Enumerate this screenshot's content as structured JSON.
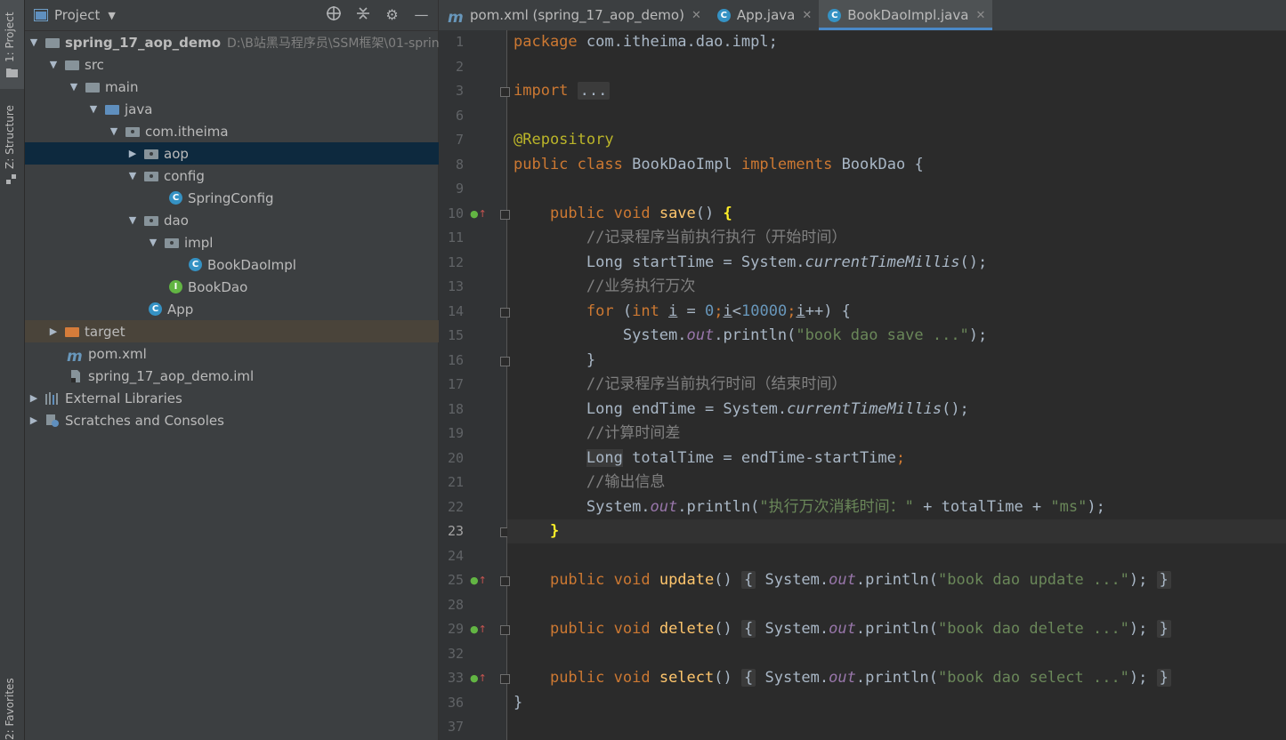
{
  "left_strip": {
    "project_tab": "1: Project",
    "structure_tab": "Z: Structure",
    "favorites_tab": "2: Favorites"
  },
  "project_panel": {
    "title": "Project",
    "tree": [
      {
        "label": "spring_17_aop_demo",
        "path": "D:\\B站黑马程序员\\SSM框架\\01-sprin",
        "icon": "module-folder-icon"
      },
      {
        "label": "src",
        "icon": "folder-icon"
      },
      {
        "label": "main",
        "icon": "folder-icon"
      },
      {
        "label": "java",
        "icon": "source-folder-icon"
      },
      {
        "label": "com.itheima",
        "icon": "package-icon"
      },
      {
        "label": "aop",
        "icon": "package-icon"
      },
      {
        "label": "config",
        "icon": "package-icon"
      },
      {
        "label": "SpringConfig",
        "icon": "class-icon"
      },
      {
        "label": "dao",
        "icon": "package-icon"
      },
      {
        "label": "impl",
        "icon": "package-icon"
      },
      {
        "label": "BookDaoImpl",
        "icon": "class-icon"
      },
      {
        "label": "BookDao",
        "icon": "interface-icon"
      },
      {
        "label": "App",
        "icon": "runnable-class-icon"
      },
      {
        "label": "target",
        "icon": "excluded-folder-icon"
      },
      {
        "label": "pom.xml",
        "icon": "maven-icon"
      },
      {
        "label": "spring_17_aop_demo.iml",
        "icon": "iml-file-icon"
      },
      {
        "label": "External Libraries",
        "icon": "library-icon"
      },
      {
        "label": "Scratches and Consoles",
        "icon": "scratches-icon"
      }
    ]
  },
  "tabs": [
    {
      "label": "pom.xml (spring_17_aop_demo)",
      "icon": "maven-icon"
    },
    {
      "label": "App.java",
      "icon": "runnable-class-icon"
    },
    {
      "label": "BookDaoImpl.java",
      "icon": "class-icon",
      "active": true
    }
  ],
  "editor": {
    "line_numbers": [
      "1",
      "2",
      "3",
      "6",
      "7",
      "8",
      "9",
      "10",
      "11",
      "12",
      "13",
      "14",
      "15",
      "16",
      "17",
      "18",
      "19",
      "20",
      "21",
      "22",
      "23",
      "24",
      "25",
      "28",
      "29",
      "32",
      "33",
      "36",
      "37"
    ],
    "current_line": "23",
    "text": {
      "package_kw": "package",
      "package_name": " com.itheima.dao.impl;",
      "import_kw": "import",
      "import_fold": "...",
      "annotation": "@Repository",
      "public": "public",
      "class": "class",
      "classname": "BookDaoImpl",
      "implements": "implements",
      "iface": "BookDao",
      "open_brace": " {",
      "void": "void",
      "save": "save",
      "update": "update",
      "delete": "delete",
      "select": "select",
      "parens": "()",
      "brace_open": "{",
      "brace_close": "}",
      "comment1": "//记录程序当前执行执行（开始时间）",
      "long_type": "Long",
      "start_var": " startTime = System.",
      "current_millis": "currentTimeMillis",
      "call_end": "();",
      "comment2": "//业务执行万次",
      "for_kw": "for",
      "int_kw": "int",
      "loop_i": "i",
      "zero": "0",
      "ten_k": "10000",
      "system_out": "System.",
      "out": "out",
      "println": ".println(",
      "str_save": "\"book dao save ...\"",
      "str_update": "\"book dao update ...\"",
      "str_delete": "\"book dao delete ...\"",
      "str_select": "\"book dao select ...\"",
      "close_call": ");",
      "comment3": "//记录程序当前执行时间（结束时间）",
      "end_var": " endTime = System.",
      "comment4": "//计算时间差",
      "total_var": " totalTime = endTime-startTime",
      "comment5": "//输出信息",
      "str_cost": "\"执行万次消耗时间：\"",
      "plus_total": " + totalTime + ",
      "str_ms": "\"ms\""
    }
  }
}
